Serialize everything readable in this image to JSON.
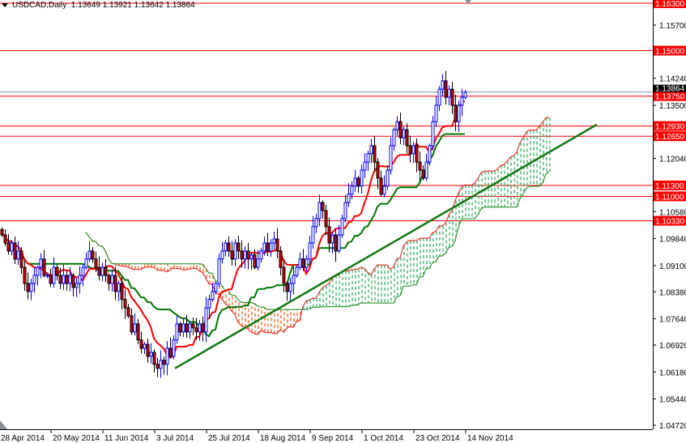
{
  "header": {
    "symbol": "USDCAD,Daily",
    "ohlc": "1.13649 1.13921 1.13642 1.13864"
  },
  "colors": {
    "bull_outline": "#0000ff",
    "bear_body": "#e00000",
    "tenkan": "#ff0000",
    "kijun": "#007700",
    "cloud_bear": "#ff5500",
    "cloud_bull": "#22aa55",
    "level_line": "#ff0000",
    "trendline": "#117711",
    "current_price_bg": "#000000"
  },
  "chart_data": {
    "type": "candlestick",
    "title": "USDCAD,Daily",
    "ylim": [
      1.0472,
      1.163
    ],
    "y_ticks": [
      "1.15700",
      "1.14240",
      "1.13500",
      "1.12040",
      "1.10580",
      "1.09840",
      "1.09100",
      "1.08380",
      "1.07640",
      "1.06920",
      "1.06180",
      "1.05440",
      "1.04720"
    ],
    "x_ticks": [
      "28 Apr 2014",
      "20 May 2014",
      "11 Jun 2014",
      "3 Jul 2014",
      "25 Jul 2014",
      "18 Aug 2014",
      "9 Sep 2014",
      "1 Oct 2014",
      "23 Oct 2014",
      "14 Nov 2014"
    ],
    "x_tick_every_bars": 16,
    "closes": [
      1.0994,
      1.0972,
      1.095,
      1.0972,
      1.0928,
      1.095,
      1.0905,
      1.0861,
      1.0839,
      1.0861,
      1.0883,
      1.0905,
      1.0928,
      1.0883,
      1.0883,
      1.0861,
      1.0905,
      1.0883,
      1.0861,
      1.0883,
      1.0861,
      1.0883,
      1.085,
      1.0861,
      1.0883,
      1.0905,
      1.0928,
      1.095,
      1.0928,
      1.0905,
      1.0883,
      1.0905,
      1.0883,
      1.0861,
      1.0883,
      1.0839,
      1.0861,
      1.0817,
      1.0794,
      1.0772,
      1.0728,
      1.075,
      1.0706,
      1.0683,
      1.0694,
      1.0661,
      1.0672,
      1.0639,
      1.0628,
      1.065,
      1.0639,
      1.0683,
      1.0661,
      1.0706,
      1.075,
      1.0728,
      1.075,
      1.0728,
      1.075,
      1.0739,
      1.0728,
      1.075,
      1.0728,
      1.0794,
      1.0817,
      1.0839,
      1.0861,
      1.0928,
      1.095,
      1.0972,
      1.095,
      1.0928,
      1.0972,
      1.095,
      1.0928,
      1.095,
      1.0928,
      1.0939,
      1.0905,
      1.0928,
      1.095,
      1.0972,
      1.095,
      1.0972,
      1.0983,
      1.095,
      1.0905,
      1.0861,
      1.0839,
      1.0861,
      1.0883,
      1.0905,
      1.0928,
      1.0905,
      1.0928,
      1.0972,
      1.1017,
      1.1039,
      1.1083,
      1.1061,
      1.1017,
      1.0972,
      1.0994,
      1.095,
      1.0994,
      1.1039,
      1.1083,
      1.1106,
      1.1128,
      1.115,
      1.1128,
      1.1172,
      1.1194,
      1.1217,
      1.1239,
      1.1194,
      1.115,
      1.1106,
      1.1128,
      1.1172,
      1.1239,
      1.1283,
      1.1305,
      1.1261,
      1.1283,
      1.1239,
      1.1217,
      1.1239,
      1.1194,
      1.1172,
      1.115,
      1.1194,
      1.1239,
      1.1305,
      1.135,
      1.1394,
      1.1417,
      1.1372,
      1.1394,
      1.135,
      1.1305,
      1.135,
      1.1372,
      1.1386
    ],
    "current_price": "1.13864",
    "current_price_value": 1.13864,
    "levels": [
      {
        "value": 1.163,
        "label": "1.16300"
      },
      {
        "value": 1.15,
        "label": "1.15000"
      },
      {
        "value": 1.1375,
        "label": "1.13750"
      },
      {
        "value": 1.1293,
        "label": "1.12930"
      },
      {
        "value": 1.1265,
        "label": "1.12650"
      },
      {
        "value": 1.113,
        "label": "1.11300"
      },
      {
        "value": 1.11,
        "label": "1.11000"
      },
      {
        "value": 1.1033,
        "label": "1.10330"
      }
    ],
    "trendline": {
      "from_bar": 53.5,
      "from_price": 1.0628,
      "to_bar": 183.75,
      "to_price": 1.1297
    },
    "ichimoku": {
      "tenkan": 9,
      "kijun": 26,
      "senkou_b": 52,
      "shift": 26
    }
  }
}
